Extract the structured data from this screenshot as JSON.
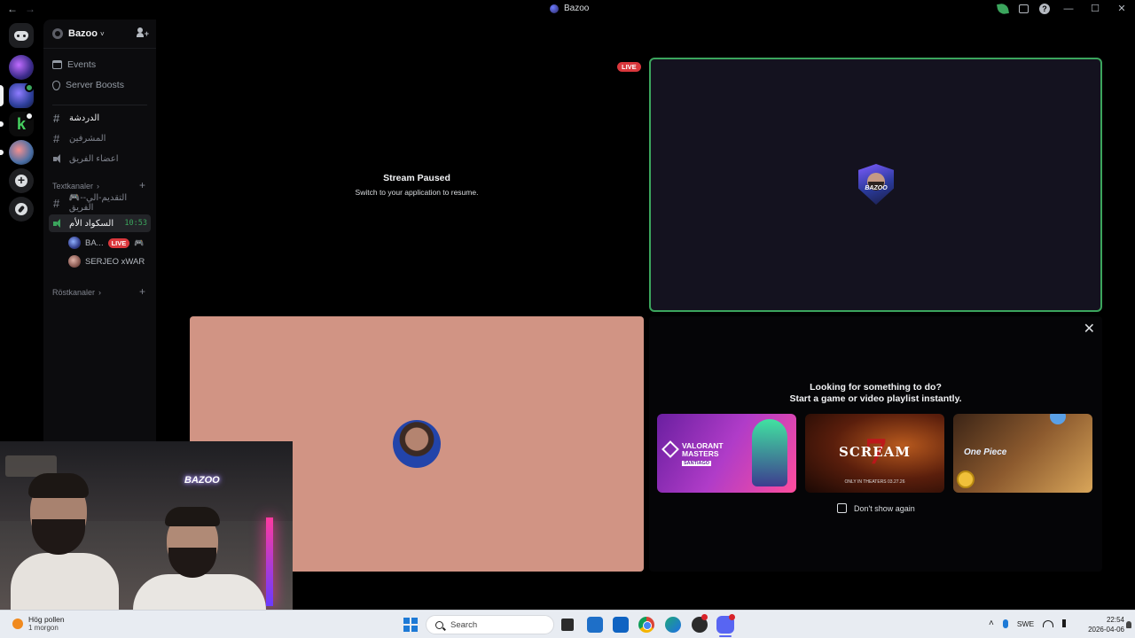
{
  "window": {
    "title": "Bazoo",
    "back_glyph": "←",
    "forward_glyph": "→",
    "minimize_glyph": "—",
    "maximize_glyph": "☐",
    "close_glyph": "✕"
  },
  "guild": {
    "name": "Bazoo",
    "chevron": "˅"
  },
  "nav": {
    "events": "Events",
    "server_boosts": "Server Boosts"
  },
  "channels_top": [
    {
      "name": "الدردشة",
      "type": "text"
    },
    {
      "name": "المشرفين",
      "type": "text"
    },
    {
      "name": "اعضاء الفريق",
      "type": "voice"
    }
  ],
  "categories": {
    "text": "Textkanaler",
    "voice": "Röstkanaler"
  },
  "text_category_channel": "🎮-التقديم-الي-الفريق",
  "voice_channel": {
    "name": "السكواد الأم",
    "timer": "10:53"
  },
  "voice_users": [
    {
      "name": "BA...",
      "live": "LIVE",
      "activity_icon": "🎮"
    },
    {
      "name": "SERJEO xWAR"
    }
  ],
  "stream": {
    "live_label": "LIVE",
    "paused_title": "Stream Paused",
    "paused_sub": "Switch to your application to resume."
  },
  "avatar_badge_text": "BAZOO",
  "webcam_neon": "BAZOO",
  "suggestion": {
    "title": "Looking for something to do?",
    "subtitle": "Start a game or video playlist instantly.",
    "close_glyph": "✕",
    "cards": [
      {
        "title": "VALORANT MASTERS",
        "sub": "SANTIAGO"
      },
      {
        "title": "SCREAM",
        "numeral": "7",
        "sub": "ONLY IN THEATERS 03.27.26"
      },
      {
        "title": "One Piece"
      }
    ],
    "dont_show": "Don't show again"
  },
  "taskbar": {
    "weather_line1": "Hög pollen",
    "weather_line2": "1 morgon",
    "search_placeholder": "Search",
    "lang": "SWE",
    "time": "22:54",
    "date": "2026-04-06",
    "tray_chevron": "˄"
  },
  "colors": {
    "live_red": "#da373c",
    "speaking_green": "#3ba55d",
    "discord_blurple": "#5865f2"
  }
}
